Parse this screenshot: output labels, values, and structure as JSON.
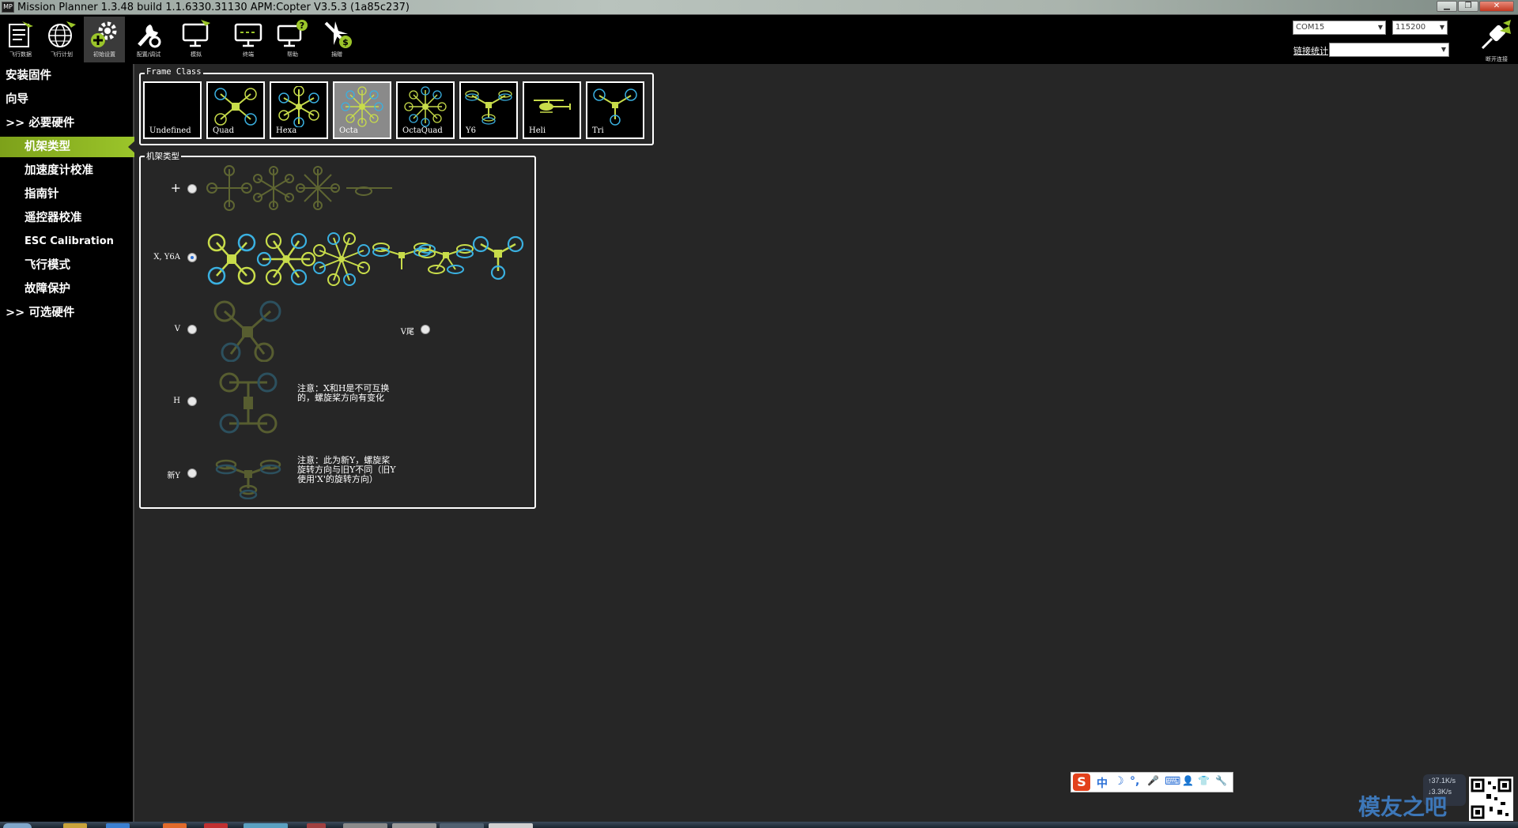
{
  "window": {
    "title": "Mission Planner 1.3.48 build 1.1.6330.31130 APM:Copter V3.5.3 (1a85c237)",
    "logo_text": "MP",
    "buttons": [
      "▁",
      "❐",
      "✕"
    ]
  },
  "toolbar": {
    "items": [
      {
        "label": "飞行数据",
        "icon": "flight-data-icon"
      },
      {
        "label": "飞行计划",
        "icon": "flight-plan-icon"
      },
      {
        "label": "初始设置",
        "icon": "initial-setup-icon"
      },
      {
        "label": "配置/调试",
        "icon": "config-tuning-icon"
      },
      {
        "label": "模拟",
        "icon": "simulation-icon"
      },
      {
        "label": "终端",
        "icon": "terminal-icon"
      },
      {
        "label": "帮助",
        "icon": "help-icon"
      },
      {
        "label": "捐赠",
        "icon": "donate-icon"
      }
    ],
    "port_value": "COM15",
    "baud_value": "115200",
    "stats_label": "链接统计",
    "stats_value": "",
    "connect_label": "断开连接"
  },
  "sidebar": {
    "items": [
      {
        "label": "安装固件"
      },
      {
        "label": "向导"
      },
      {
        "label": ">> 必要硬件"
      },
      {
        "label": "机架类型"
      },
      {
        "label": "加速度计校准"
      },
      {
        "label": "指南针"
      },
      {
        "label": "遥控器校准"
      },
      {
        "label": "ESC Calibration"
      },
      {
        "label": "飞行模式"
      },
      {
        "label": "故障保护"
      },
      {
        "label": ">> 可选硬件"
      }
    ]
  },
  "frame_class": {
    "title": "Frame Class",
    "selected": "Octa",
    "options": [
      "Undefined",
      "Quad",
      "Hexa",
      "Octa",
      "OctaQuad",
      "Y6",
      "Heli",
      "Tri"
    ]
  },
  "frame_type": {
    "title": "机架类型",
    "rows": [
      {
        "label": "+",
        "checked": false
      },
      {
        "label": "X, Y6A",
        "checked": true
      },
      {
        "label": "V",
        "checked": false
      },
      {
        "label": "V尾",
        "checked": false
      },
      {
        "label": "H",
        "checked": false
      },
      {
        "label": "新Y",
        "checked": false
      }
    ],
    "note_h": [
      "注意：X和H是不可互换",
      "的，螺旋桨方向有变化"
    ],
    "note_y": [
      "注意：此为新Y，螺旋桨",
      "旋转方向与旧Y不同（旧Y",
      "使用'X'的旋转方向）"
    ]
  },
  "ime": {
    "items": [
      "S",
      "中",
      "☽",
      "°,",
      "🎤",
      "⌨",
      "👤",
      "👕",
      "🔧"
    ]
  },
  "tray": {
    "up": "↑37.1K/s",
    "down": "↓3.3K/s"
  },
  "watermark": "模友之吧",
  "colors": {
    "accent": "#9bc52a",
    "motor_yellow": "#c8dc4a",
    "motor_blue": "#3ab0e0",
    "background": "#262626"
  }
}
